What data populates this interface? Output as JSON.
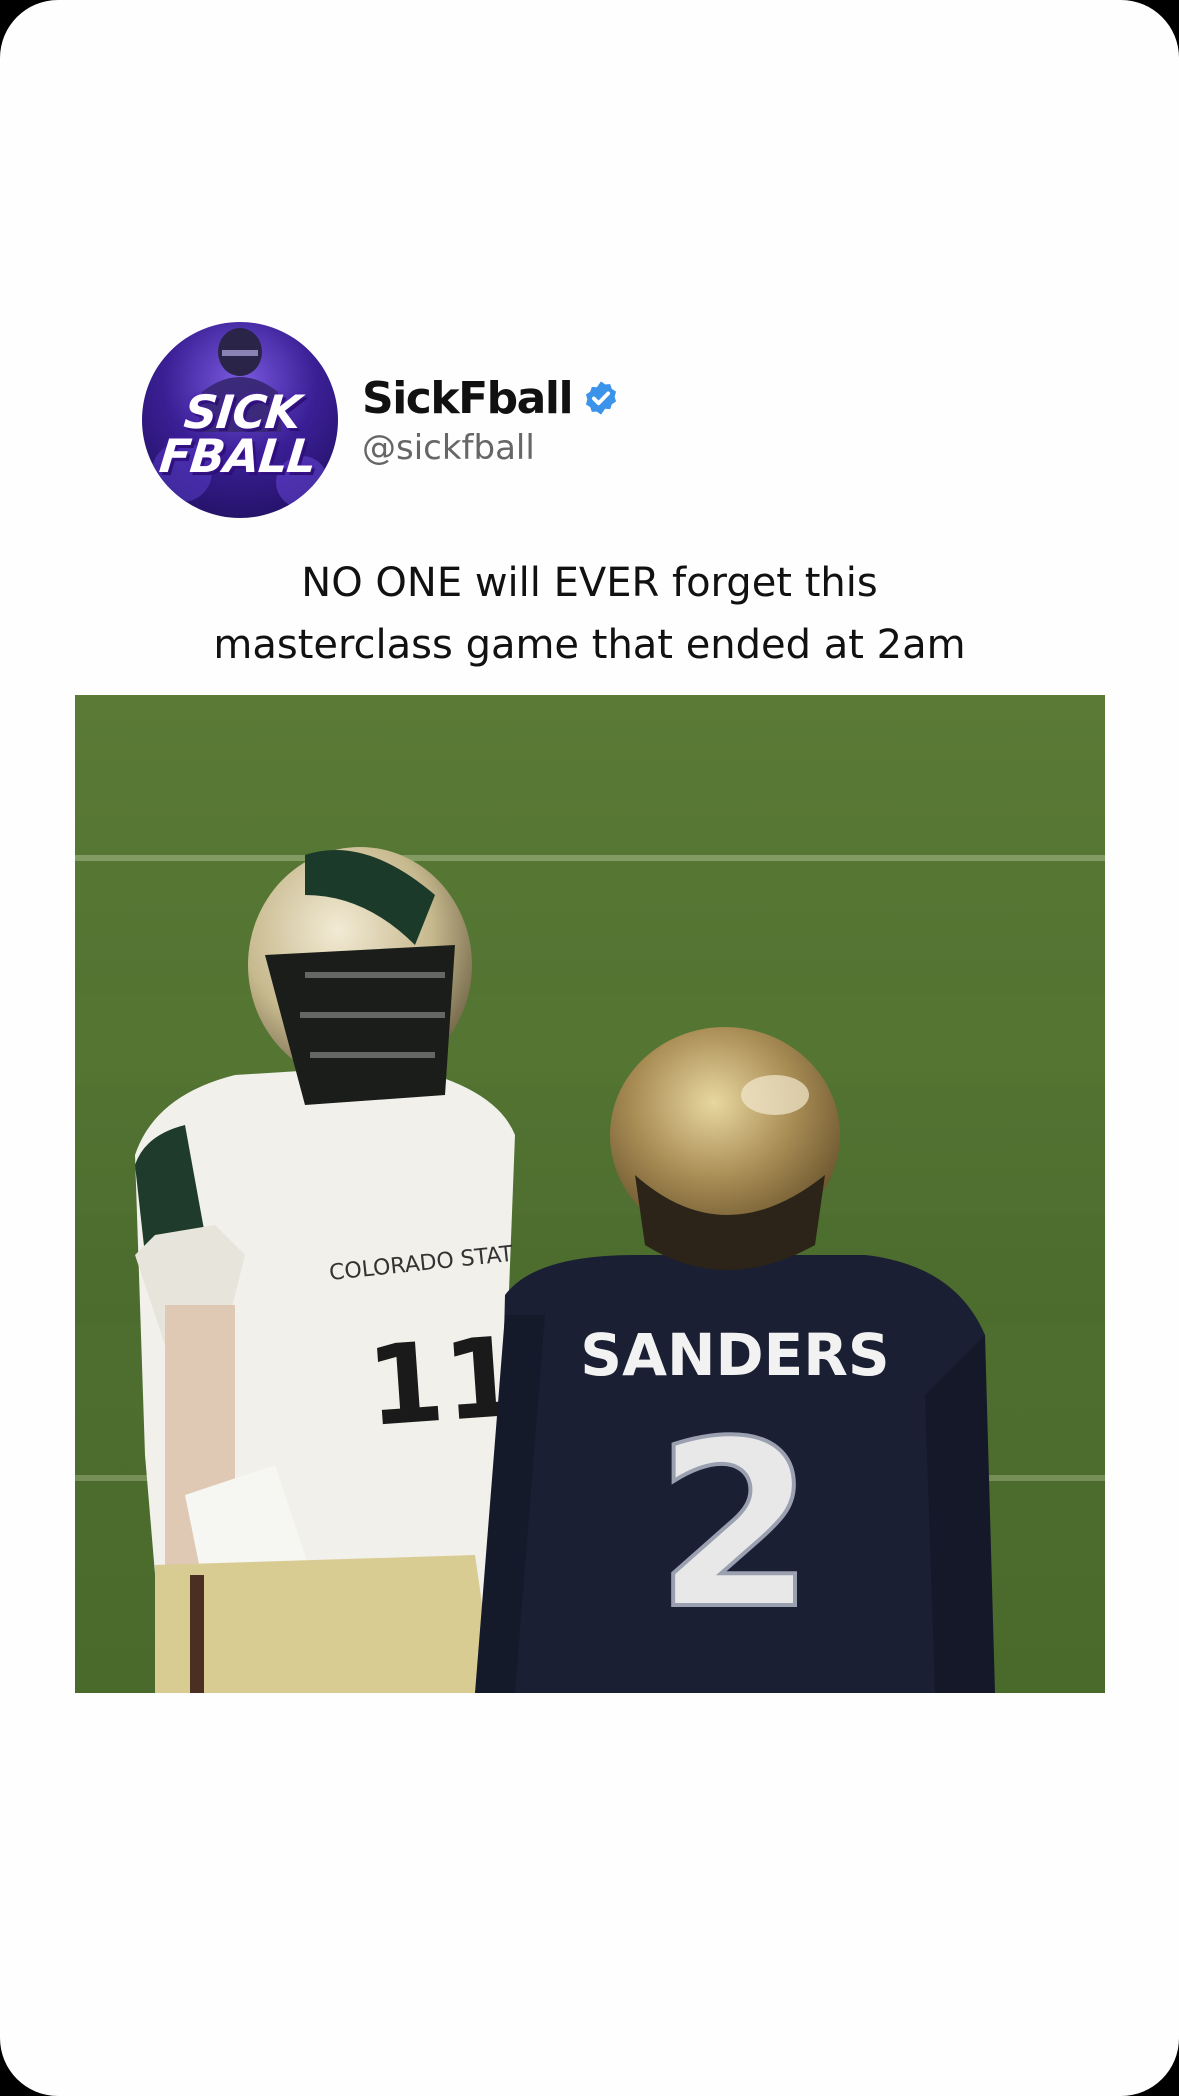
{
  "post": {
    "account": {
      "display_name": "SickFball",
      "handle": "@sickfball",
      "avatar_text_line1": "SICK",
      "avatar_text_line2": "FBALL",
      "verified": true,
      "verified_color": "#3b93ea"
    },
    "caption_line1": "NO ONE will EVER forget this",
    "caption_line2": "masterclass game that ended at 2am",
    "media": {
      "left_jersey_team": "COLORADO STAT",
      "left_jersey_number": "11",
      "right_jersey_name": "SANDERS",
      "right_jersey_number": "2"
    }
  }
}
